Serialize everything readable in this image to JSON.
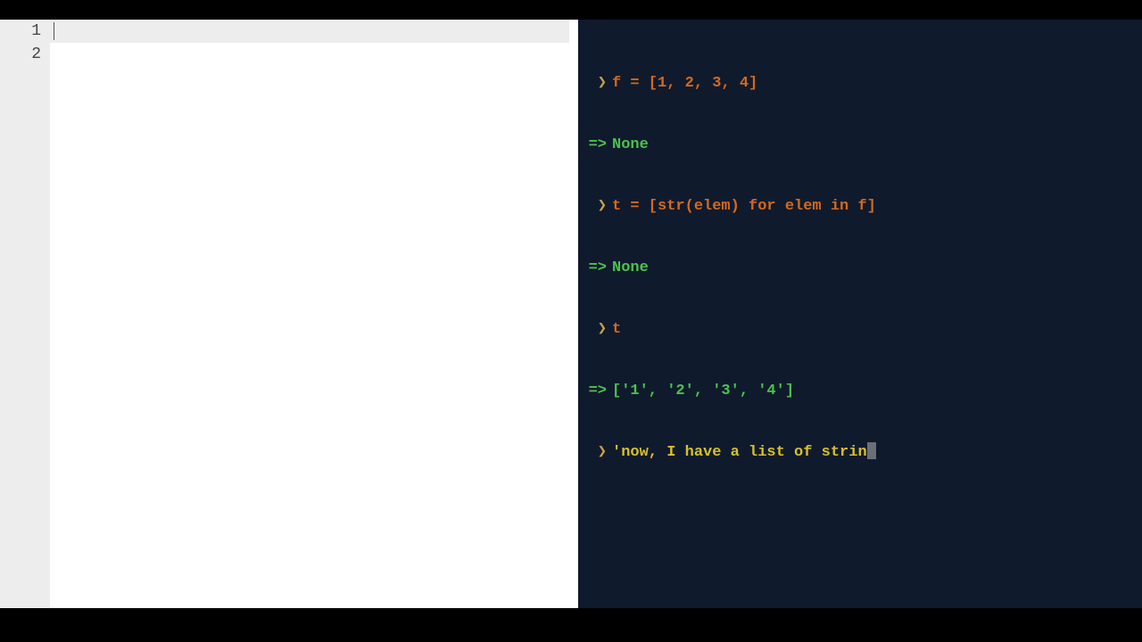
{
  "editor": {
    "line_numbers": [
      "1",
      "2"
    ]
  },
  "repl": {
    "prompt": "❯",
    "arrow": "=>",
    "lines": [
      {
        "kind": "input",
        "text": "f = [1, 2, 3, 4]"
      },
      {
        "kind": "result",
        "text": "None",
        "color": "green"
      },
      {
        "kind": "input",
        "text": "t = [str(elem) for elem in f]"
      },
      {
        "kind": "result",
        "text": "None",
        "color": "green"
      },
      {
        "kind": "input",
        "text": "t"
      },
      {
        "kind": "result",
        "text": "['1', '2', '3', '4']",
        "color": "green"
      },
      {
        "kind": "active",
        "text": "'now, I have a list of strin"
      }
    ]
  }
}
